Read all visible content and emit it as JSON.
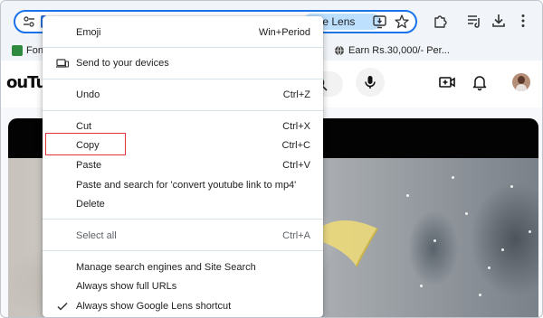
{
  "omnibox": {
    "lens_chip_label": "gle Lens"
  },
  "bookmarks": [
    {
      "label": "Fon"
    },
    {
      "label": "Earn Rs.30,000/- Per..."
    }
  ],
  "youtube": {
    "logo_text": "ouTube"
  },
  "context_menu": {
    "items": [
      {
        "label": "Emoji",
        "shortcut": "Win+Period"
      },
      {
        "label": "Send to your devices",
        "shortcut": ""
      },
      {
        "label": "Undo",
        "shortcut": "Ctrl+Z"
      },
      {
        "label": "Cut",
        "shortcut": "Ctrl+X"
      },
      {
        "label": "Copy",
        "shortcut": "Ctrl+C"
      },
      {
        "label": "Paste",
        "shortcut": "Ctrl+V"
      },
      {
        "label": "Paste and search for 'convert youtube link to mp4'",
        "shortcut": ""
      },
      {
        "label": "Delete",
        "shortcut": ""
      },
      {
        "label": "Select all",
        "shortcut": "Ctrl+A"
      },
      {
        "label": "Manage search engines and Site Search",
        "shortcut": ""
      },
      {
        "label": "Always show full URLs",
        "shortcut": ""
      },
      {
        "label": "Always show Google Lens shortcut",
        "shortcut": "",
        "checked": true
      }
    ],
    "highlighted_item": "Copy"
  },
  "colors": {
    "highlight_border": "#e4343b",
    "omnibox_border": "#1a73e8",
    "lens_chip": "#bde0ff"
  }
}
